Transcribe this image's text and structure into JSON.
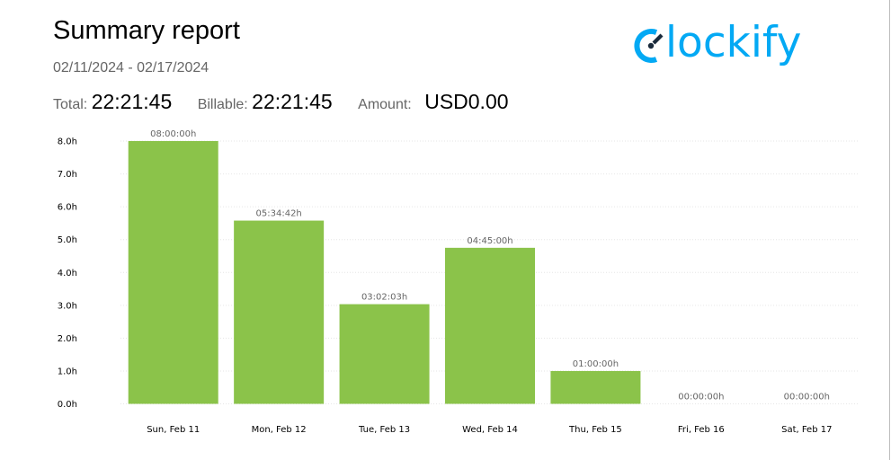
{
  "report": {
    "title": "Summary report",
    "date_range": "02/11/2024 - 02/17/2024",
    "total_label": "Total:",
    "total_value": "22:21:45",
    "billable_label": "Billable:",
    "billable_value": "22:21:45",
    "amount_label": "Amount:",
    "amount_value": "USD0.00"
  },
  "logo": {
    "text": "lockify",
    "color": "#03a9f4"
  },
  "chart_data": {
    "type": "bar",
    "categories": [
      "Sun, Feb 11",
      "Mon, Feb 12",
      "Tue, Feb 13",
      "Wed, Feb 14",
      "Thu, Feb 15",
      "Fri, Feb 16",
      "Sat, Feb 17"
    ],
    "values": [
      8.0,
      5.5783,
      3.0342,
      4.75,
      1.0,
      0.0,
      0.0
    ],
    "data_labels": [
      "08:00:00h",
      "05:34:42h",
      "03:02:03h",
      "04:45:00h",
      "01:00:00h",
      "00:00:00h",
      "00:00:00h"
    ],
    "y_ticks": [
      "0.0h",
      "1.0h",
      "2.0h",
      "3.0h",
      "4.0h",
      "5.0h",
      "6.0h",
      "7.0h",
      "8.0h"
    ],
    "ylim": [
      0,
      8
    ],
    "grid": true,
    "bar_color": "#8bc34a",
    "title": "",
    "xlabel": "",
    "ylabel": ""
  }
}
